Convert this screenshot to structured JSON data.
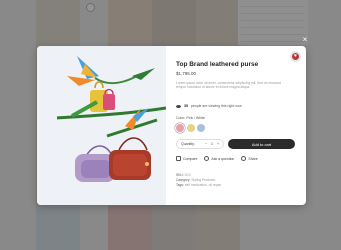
{
  "modal": {
    "close_label": "×",
    "title": "Top Brand leathered purse",
    "price": "$1,795.00",
    "description": "Lorem ipsum dolor sit amet, consectetur adipiscing elit. Sed do eiusmod tempor incididunt ut labore et dolore magna aliqua.",
    "viewers": {
      "count": "35",
      "text": "people are viewing this right now"
    },
    "color": {
      "label": "Color:",
      "selected": "Pink / White",
      "options": [
        {
          "name": "pink",
          "hex": "#e8a0ad"
        },
        {
          "name": "yellow",
          "hex": "#e6d38a"
        },
        {
          "name": "blue",
          "hex": "#a9bfdc"
        }
      ]
    },
    "quantity": {
      "label": "Quantity:",
      "minus": "−",
      "value": "1",
      "plus": "+"
    },
    "add_to_cart": "Add to cart",
    "actions": {
      "compare": "Compare",
      "question": "Ask a question",
      "share": "Share"
    },
    "meta": {
      "sku_label": "SKU:",
      "sku_value": "D10",
      "category_label": "Category:",
      "category_value": "Styling Products",
      "tags_label": "Tags:",
      "tags_value": "self medication, oil repair"
    }
  },
  "colors": {
    "accent": "#b73a3a",
    "button": "#2b2b2b"
  }
}
